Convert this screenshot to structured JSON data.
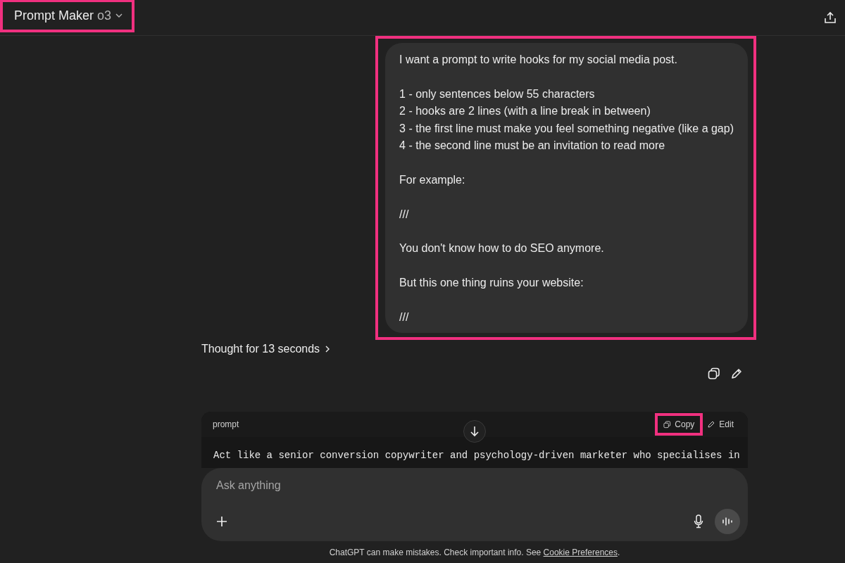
{
  "header": {
    "title": "Prompt Maker",
    "model": "o3",
    "highlighted": true
  },
  "user_message": {
    "highlighted": true,
    "blocks": [
      [
        "I want a prompt to write hooks for my social media post."
      ],
      [
        "1 - only sentences below 55 characters",
        "2 - hooks are 2 lines (with a line break in between)",
        "3 - the first line must make you feel something negative (like a gap)",
        "4 - the second line must be an invitation to read more"
      ],
      [
        "For example:"
      ],
      [
        "///"
      ],
      [
        "You don't know how to do SEO anymore."
      ],
      [
        "But this one thing ruins your website:"
      ],
      [
        "///"
      ]
    ]
  },
  "thought": {
    "label": "Thought for 13 seconds",
    "expanded": false
  },
  "code_block": {
    "language": "prompt",
    "copy_label": "Copy",
    "copy_highlighted": true,
    "edit_label": "Edit",
    "line": "Act like a senior conversion copywriter and psychology-driven marketer who specialises in"
  },
  "composer": {
    "placeholder": "Ask anything"
  },
  "footer": {
    "text": "ChatGPT can make mistakes. Check important info. See ",
    "link": "Cookie Preferences",
    "end": "."
  }
}
